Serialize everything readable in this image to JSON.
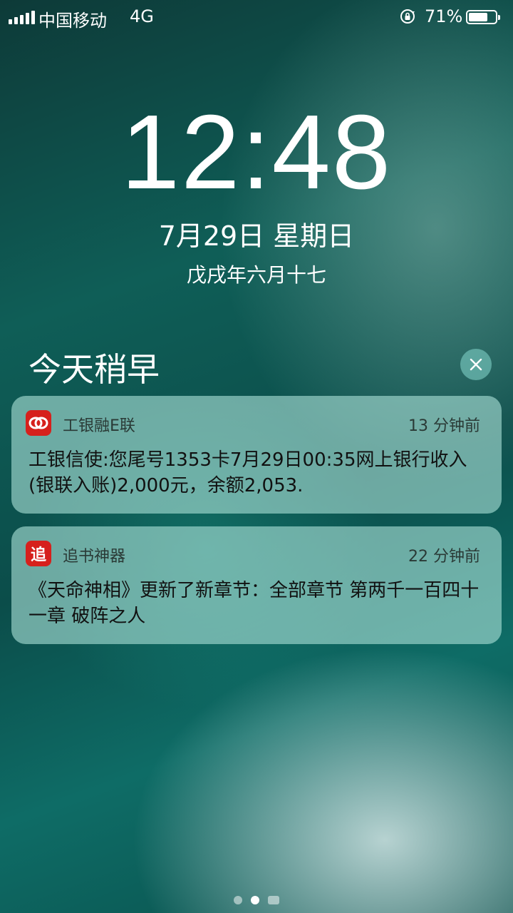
{
  "status_bar": {
    "carrier": "中国移动",
    "network": "4G",
    "battery_percent": "71%",
    "battery_level": 0.71,
    "icons": [
      "signal-bars-icon",
      "rotation-lock-icon",
      "battery-icon"
    ]
  },
  "lock_screen": {
    "time": "12:48",
    "date": "7月29日 星期日",
    "lunar_date": "戊戌年六月十七"
  },
  "notification_center": {
    "section_title": "今天稍早",
    "clear_icon": "close-icon"
  },
  "notifications": [
    {
      "app_name": "工银融E联",
      "time_ago": "13 分钟前",
      "message": "工银信使:您尾号1353卡7月29日00:35网上银行收入(银联入账)2,000元，余额2,053.",
      "icon": "icbc-rong-e-lian-app-icon",
      "icon_color": "#d6201c"
    },
    {
      "app_name": "追书神器",
      "time_ago": "22 分钟前",
      "message": "《天命神相》更新了新章节：全部章节 第两千一百四十一章  破阵之人",
      "icon": "zhuishu-app-icon",
      "icon_glyph": "追",
      "icon_color": "#d6201c"
    }
  ],
  "page_indicator": {
    "pages": 2,
    "active_index": 1,
    "icons": [
      "page-dot-icon",
      "camera-icon"
    ]
  }
}
